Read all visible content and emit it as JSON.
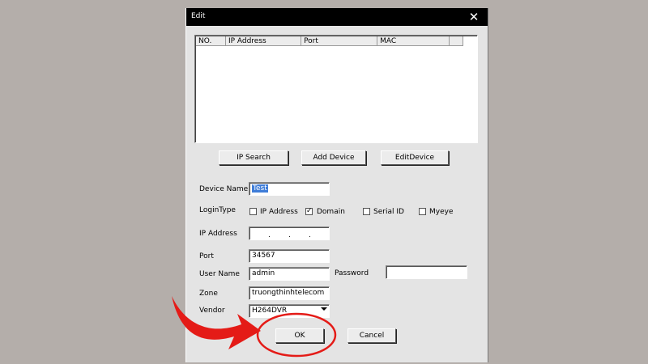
{
  "window": {
    "title": "Edit",
    "close_symbol": "✕"
  },
  "list": {
    "columns": [
      "NO.",
      "IP Address",
      "Port",
      "MAC",
      ""
    ]
  },
  "buttons": {
    "ip_search": "IP Search",
    "add_device": "Add Device",
    "edit_device": "EditDevice",
    "ok": "OK",
    "cancel": "Cancel"
  },
  "form": {
    "device_name_label": "Device Name",
    "device_name_value": "Test",
    "login_type_label": "LoginType",
    "login_types": [
      {
        "label": "IP Address",
        "checked": false
      },
      {
        "label": "Domain",
        "checked": true
      },
      {
        "label": "Serial ID",
        "checked": false
      },
      {
        "label": "Myeye",
        "checked": false
      }
    ],
    "check_mark": "✓",
    "ip_address_label": "IP Address",
    "ip_dots": ".",
    "port_label": "Port",
    "port_value": "34567",
    "user_name_label": "User Name",
    "user_name_value": "admin",
    "password_label": "Password",
    "password_value": "",
    "zone_label": "Zone",
    "zone_value": "truongthinhtelecom",
    "vendor_label": "Vendor",
    "vendor_value": "H264DVR"
  },
  "colors": {
    "annotation": "#e41b17",
    "selection": "#3f7dd8"
  },
  "icons": {
    "close": "close-icon",
    "dropdown": "chevron-down-icon",
    "pointer": "arrow-pointer-icon"
  }
}
